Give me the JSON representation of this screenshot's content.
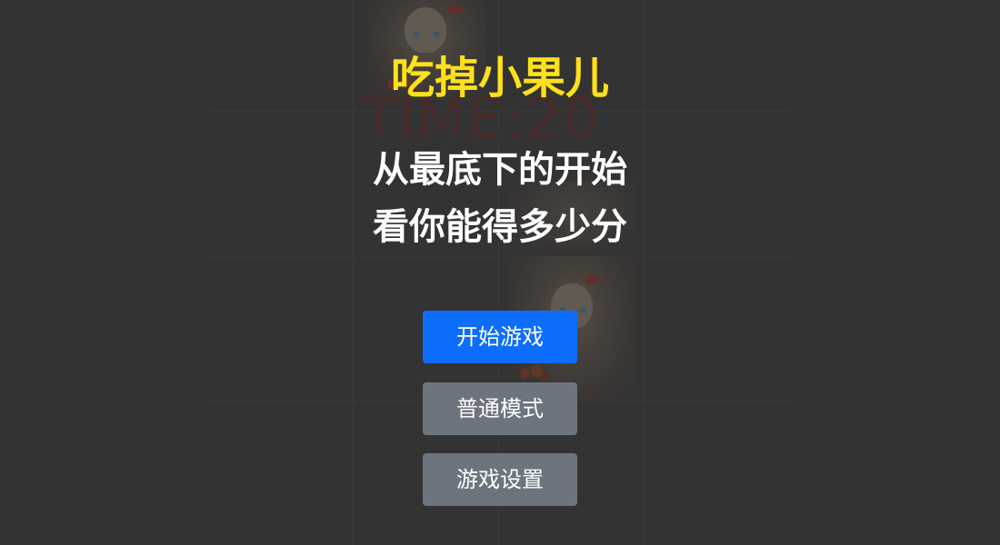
{
  "game": {
    "title": "吃掉小果儿",
    "subtitle_line1": "从最底下的开始",
    "subtitle_line2": "看你能得多少分",
    "background_timer_text": "TIME:20"
  },
  "menu": {
    "start_label": "开始游戏",
    "normal_mode_label": "普通模式",
    "settings_label": "游戏设置"
  },
  "colors": {
    "overlay": "#333333",
    "title": "#ffe11a",
    "text": "#ffffff",
    "primary_button": "#0d6efd",
    "secondary_button": "#6c757d"
  }
}
